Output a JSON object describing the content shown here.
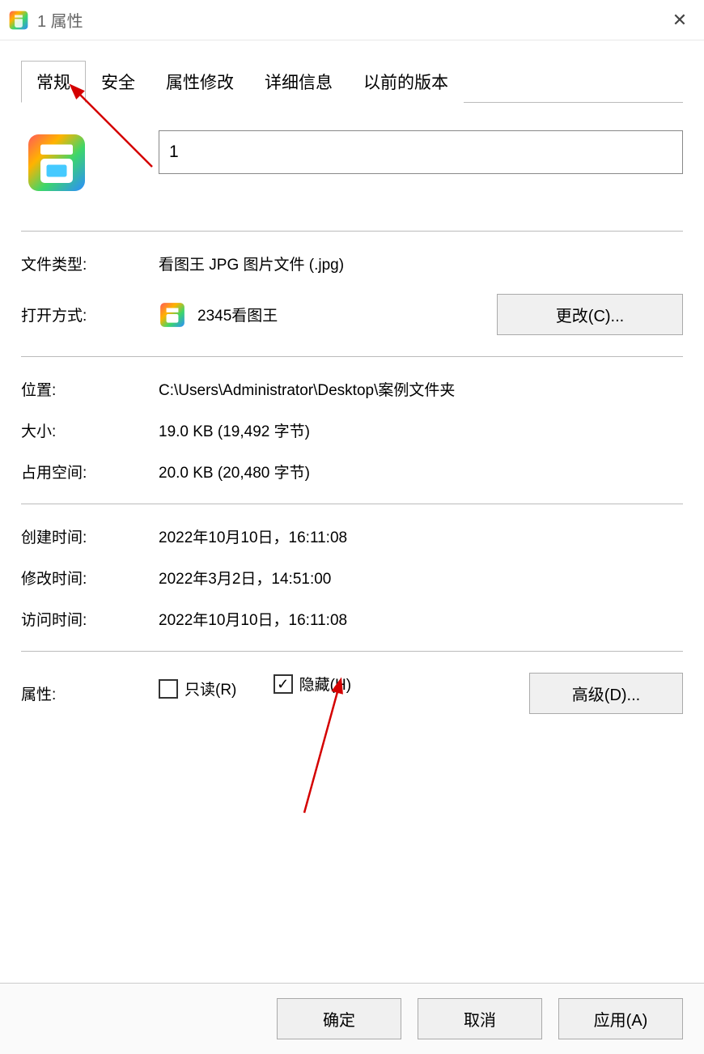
{
  "titlebar": {
    "text": "1 属性"
  },
  "tabs": {
    "items": [
      "常规",
      "安全",
      "属性修改",
      "详细信息",
      "以前的版本"
    ],
    "active": 0
  },
  "filename": "1",
  "labels": {
    "filetype": "文件类型:",
    "openwith": "打开方式:",
    "location": "位置:",
    "size": "大小:",
    "sizedisk": "占用空间:",
    "created": "创建时间:",
    "modified": "修改时间:",
    "accessed": "访问时间:",
    "attributes": "属性:"
  },
  "values": {
    "filetype": "看图王 JPG 图片文件 (.jpg)",
    "openwith": "2345看图王",
    "location": "C:\\Users\\Administrator\\Desktop\\案例文件夹",
    "size": "19.0 KB (19,492 字节)",
    "sizedisk": "20.0 KB (20,480 字节)",
    "created": "2022年10月10日，16:11:08",
    "modified": "2022年3月2日，14:51:00",
    "accessed": "2022年10月10日，16:11:08"
  },
  "buttons": {
    "change": "更改(C)...",
    "advanced": "高级(D)...",
    "ok": "确定",
    "cancel": "取消",
    "apply": "应用(A)"
  },
  "checkboxes": {
    "readonly": {
      "label": "只读(R)",
      "checked": false
    },
    "hidden": {
      "label": "隐藏(H)",
      "checked": true
    }
  }
}
